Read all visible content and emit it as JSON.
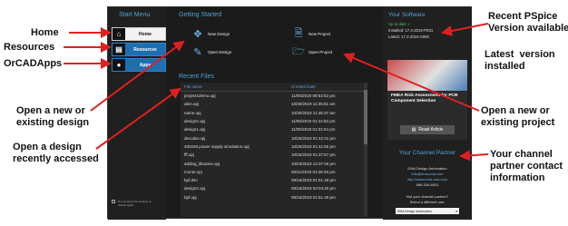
{
  "annotations": {
    "home": "Home",
    "resources": "Resources",
    "orcadapps": "OrCADApps",
    "open_new_design": "Open a new or\nexisting design",
    "open_recent_design": "Open a design\nrecently accessed",
    "recent_pspice": "Recent PSpice\nVersion available",
    "latest_version": "Latest  version\ninstalled",
    "open_new_project": "Open a new or\nexisting project",
    "channel_partner": "Your channel\npartner contact\ninformation"
  },
  "sidebar": {
    "title": "Start Menu",
    "items": [
      {
        "label": "Home",
        "icon": "home-icon"
      },
      {
        "label": "Resources",
        "icon": "book-icon"
      },
      {
        "label": "Apps",
        "icon": "apps-icon"
      }
    ],
    "dont_show": "Do not show this window on startup again."
  },
  "getting_started": {
    "title": "Getting Started",
    "new_design": "New Design",
    "open_design": "Open Design",
    "new_project": "New Project",
    "open_project": "Open Project"
  },
  "recent_files": {
    "title": "Recent Files",
    "col_name": "File name",
    "col_date": "Created Date",
    "rows": [
      {
        "name": "project1demo.opj",
        "date": "11/05/2019 09:53:52 pm"
      },
      {
        "name": "abm.opj",
        "date": "10/30/2019 11:35:51 am"
      },
      {
        "name": "name.opj",
        "date": "10/30/2019 11:45:37 am"
      },
      {
        "name": "design2.opj",
        "date": "11/05/2019 01:44:52 pm"
      },
      {
        "name": "design1.opj",
        "date": "11/05/2019 01:31:54 pm"
      },
      {
        "name": "decoder.opj",
        "date": "10/25/2019 01:42:41 pm"
      },
      {
        "name": "400248 power supply simulation.opj",
        "date": "10/25/2019 01:41:56 pm"
      },
      {
        "name": "fff.opj",
        "date": "10/25/2019 01:37:57 pm"
      },
      {
        "name": "adding_libraries.opj",
        "date": "10/03/2019 12:37:46 pm"
      },
      {
        "name": "monte.opj",
        "date": "06/11/2019 01:26:49 pm"
      },
      {
        "name": "bpf.dsn",
        "date": "09/16/2019 01:51:49 pm"
      },
      {
        "name": "design2.opj",
        "date": "09/16/2019 02:04:20 pm"
      },
      {
        "name": "bpf.opj",
        "date": "09/16/2019 01:51:49 pm"
      }
    ]
  },
  "software": {
    "title": "Your Software",
    "status": "Up to date",
    "installed_label": "Installed:",
    "installed_version": "17.4-2019-P001",
    "latest_label": "Latest:",
    "latest_version": "17.2-2016-S060"
  },
  "article": {
    "title": "FMEA Risk Assessment for PCB Component Selection",
    "button": "Read Article"
  },
  "partner": {
    "title": "Your Channel Partner",
    "name": "EMA Design Automation",
    "email": "info@ema-eda.com",
    "website": "http://www.ema-eda.com",
    "phone": "585-334-6001",
    "not_partner": "Not your channel partner?",
    "select_prompt": "Select a different one:",
    "selected": "EMA Design Automation"
  }
}
